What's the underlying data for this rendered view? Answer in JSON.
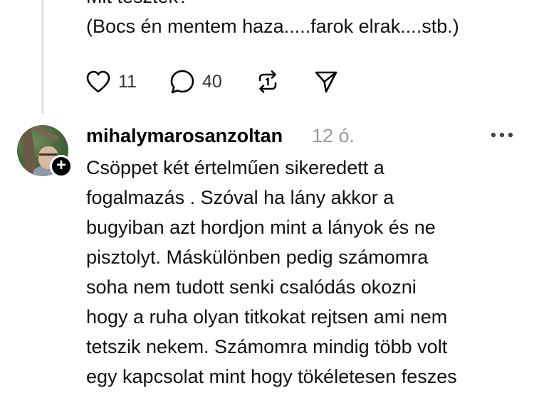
{
  "previous_post": {
    "lines": [
      "Mit tesztek?",
      "(Bocs én mentem haza.....farok elrak....stb.)"
    ],
    "actions": {
      "like_icon": "heart-icon",
      "like_count": "11",
      "comment_icon": "comment-icon",
      "comment_count": "40",
      "repost_icon": "repost-icon",
      "share_icon": "send-icon"
    }
  },
  "comment": {
    "username": "mihalymarosanzoltan",
    "timestamp": "12 ó.",
    "more_icon": "more-icon",
    "follow_icon": "plus-icon",
    "lines": [
      "Csöppet két értelműen sikeredett a",
      "fogalmazás . Szóval ha lány akkor a",
      "bugyiban azt hordjon mint a lányok és ne",
      "pisztolyt. Máskülönben pedig számomra",
      "soha nem tudott senki csalódás okozni",
      "hogy a ruha olyan titkokat rejtsen ami nem",
      "tetszik nekem. Számomra mindig több volt",
      "egy kapcsolat mint hogy tökéletesen feszes"
    ]
  }
}
